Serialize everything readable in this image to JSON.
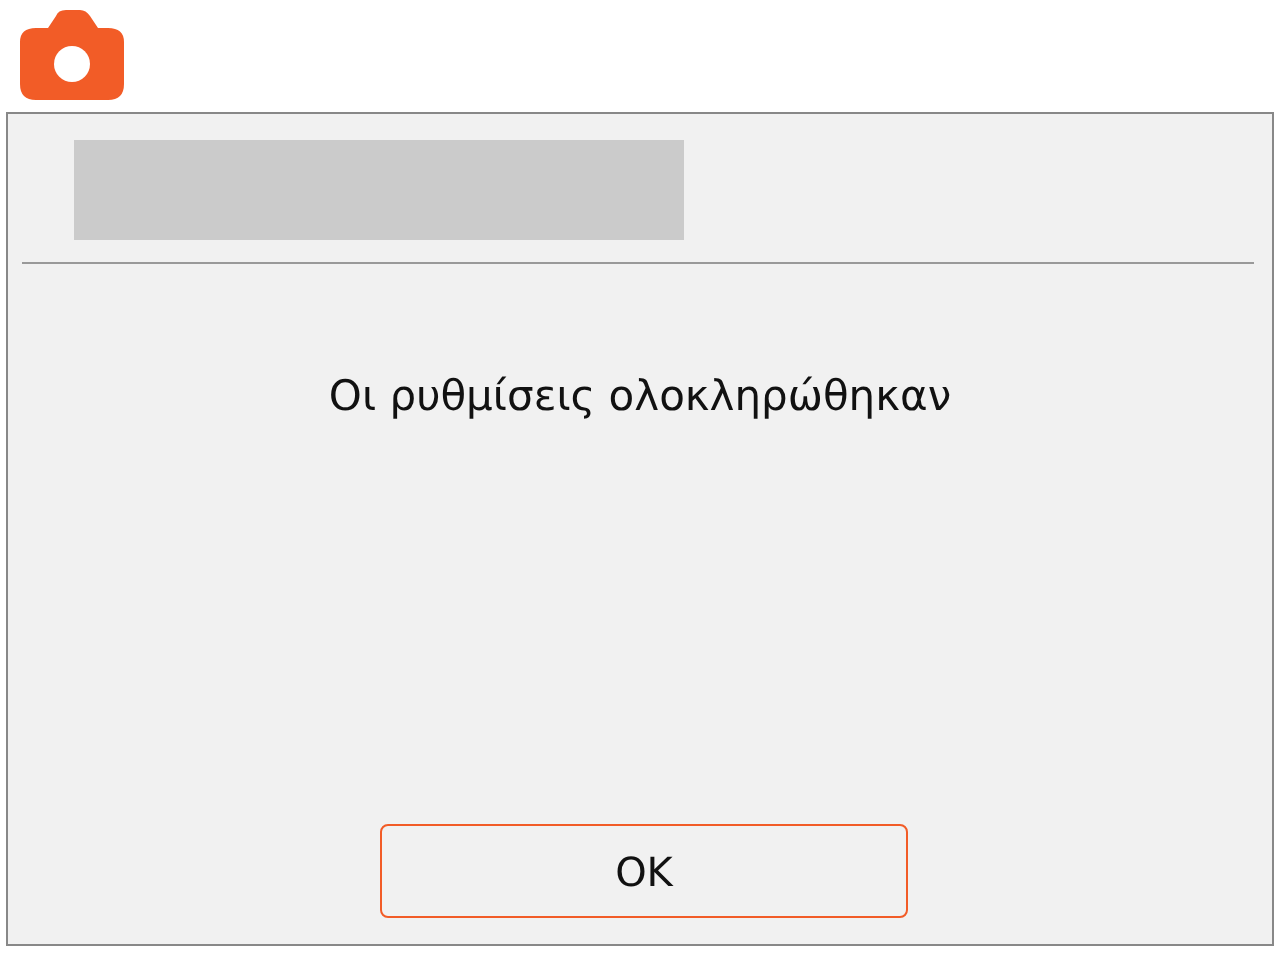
{
  "dialog": {
    "message": "Οι ρυθμίσεις ολοκληρώθηκαν",
    "buttons": [
      {
        "label": "OK"
      }
    ]
  }
}
